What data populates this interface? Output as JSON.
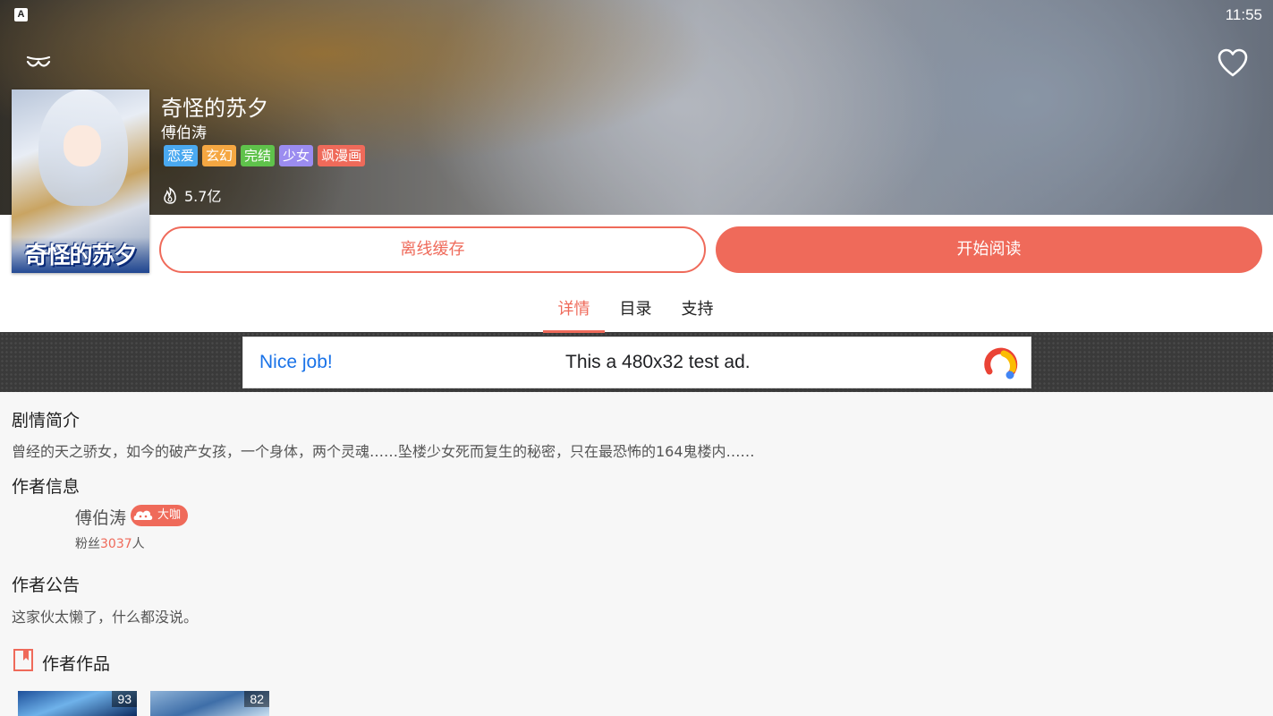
{
  "status": {
    "app_badge": "A",
    "time": "11:55"
  },
  "header": {
    "back_icon": "back-icon",
    "favorite_icon": "heart-icon"
  },
  "book": {
    "title": "奇怪的苏夕",
    "author": "傅伯涛",
    "cover_title": "奇怪的苏夕",
    "tags": [
      {
        "label": "恋爱",
        "color": "#4aa9f0"
      },
      {
        "label": "玄幻",
        "color": "#f5a742"
      },
      {
        "label": "完结",
        "color": "#5fc24b"
      },
      {
        "label": "少女",
        "color": "#9b8cf0"
      },
      {
        "label": "飒漫画",
        "color": "#ef6a5a"
      }
    ],
    "heat": "5.7亿"
  },
  "actions": {
    "cache_label": "离线缓存",
    "read_label": "开始阅读"
  },
  "tabs": [
    {
      "label": "详情",
      "active": true
    },
    {
      "label": "目录",
      "active": false
    },
    {
      "label": "支持",
      "active": false
    }
  ],
  "ad": {
    "headline": "Nice job!",
    "text": "This a 480x32 test ad."
  },
  "details": {
    "synopsis_title": "剧情简介",
    "synopsis": "曾经的天之骄女，如今的破产女孩，一个身体，两个灵魂……坠楼少女死而复生的秘密，只在最恐怖的164鬼楼内……",
    "author_info_title": "作者信息",
    "author_name": "傅伯涛",
    "author_badge": "大咖",
    "fans_prefix": "粉丝",
    "fans_count": "3037",
    "fans_suffix": "人",
    "notice_title": "作者公告",
    "notice_text": "这家伙太懒了，什么都没说。",
    "works_title": "作者作品"
  },
  "works": [
    {
      "score": "93"
    },
    {
      "score": "82"
    }
  ],
  "colors": {
    "accent": "#ef6a5a",
    "ad_blue": "#1a73e8"
  }
}
